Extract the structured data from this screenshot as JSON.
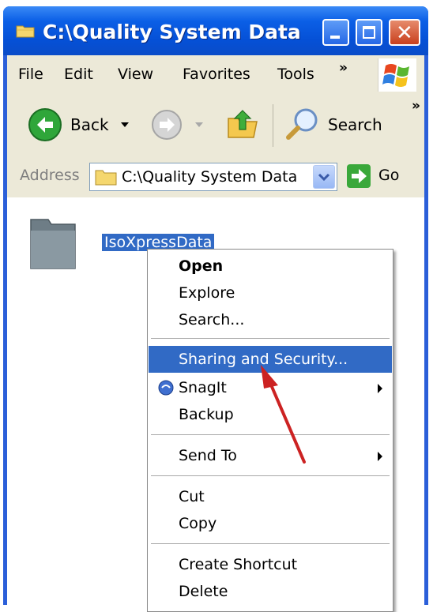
{
  "window": {
    "title": "C:\\Quality System Data"
  },
  "menubar": {
    "items": [
      "File",
      "Edit",
      "View",
      "Favorites",
      "Tools"
    ],
    "overflow": "»"
  },
  "toolbar": {
    "back_label": "Back",
    "search_label": "Search",
    "overflow": "»"
  },
  "address": {
    "label": "Address",
    "value": "C:\\Quality System Data",
    "go_label": "Go"
  },
  "folder": {
    "name": "IsoXpressData"
  },
  "context_menu": {
    "items": [
      "Open",
      "Explore",
      "Search...",
      "Sharing and Security...",
      "SnagIt",
      "Backup",
      "Send To",
      "Cut",
      "Copy",
      "Create Shortcut",
      "Delete"
    ],
    "highlighted": "Sharing and Security..."
  },
  "colors": {
    "titlebar": "#0550d6",
    "selection": "#316ac5",
    "annotation_arrow": "#cc2222"
  },
  "icons": [
    "folder-icon",
    "minimize-icon",
    "maximize-icon",
    "close-icon",
    "windows-flag-icon",
    "back-arrow-icon",
    "forward-arrow-icon",
    "up-folder-icon",
    "search-magnifier-icon",
    "go-arrow-icon",
    "snagit-icon"
  ]
}
